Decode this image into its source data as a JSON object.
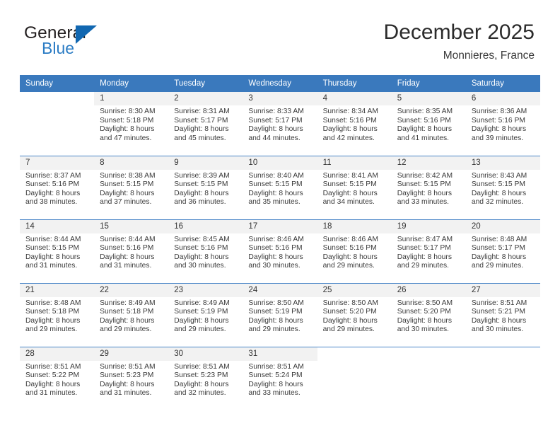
{
  "brand": {
    "name_top": "General",
    "name_bottom": "Blue",
    "accent_color": "#1167b1",
    "blue_text_color": "#2b7cc4"
  },
  "header": {
    "title": "December 2025",
    "subtitle": "Monnieres, France",
    "header_bg_color": "#3a79bd",
    "daynum_bg_color": "#f2f2f2"
  },
  "weekdays": [
    "Sunday",
    "Monday",
    "Tuesday",
    "Wednesday",
    "Thursday",
    "Friday",
    "Saturday"
  ],
  "weeks": [
    [
      {
        "day": ""
      },
      {
        "day": "1",
        "sunrise": "Sunrise: 8:30 AM",
        "sunset": "Sunset: 5:18 PM",
        "daylight_1": "Daylight: 8 hours",
        "daylight_2": "and 47 minutes."
      },
      {
        "day": "2",
        "sunrise": "Sunrise: 8:31 AM",
        "sunset": "Sunset: 5:17 PM",
        "daylight_1": "Daylight: 8 hours",
        "daylight_2": "and 45 minutes."
      },
      {
        "day": "3",
        "sunrise": "Sunrise: 8:33 AM",
        "sunset": "Sunset: 5:17 PM",
        "daylight_1": "Daylight: 8 hours",
        "daylight_2": "and 44 minutes."
      },
      {
        "day": "4",
        "sunrise": "Sunrise: 8:34 AM",
        "sunset": "Sunset: 5:16 PM",
        "daylight_1": "Daylight: 8 hours",
        "daylight_2": "and 42 minutes."
      },
      {
        "day": "5",
        "sunrise": "Sunrise: 8:35 AM",
        "sunset": "Sunset: 5:16 PM",
        "daylight_1": "Daylight: 8 hours",
        "daylight_2": "and 41 minutes."
      },
      {
        "day": "6",
        "sunrise": "Sunrise: 8:36 AM",
        "sunset": "Sunset: 5:16 PM",
        "daylight_1": "Daylight: 8 hours",
        "daylight_2": "and 39 minutes."
      }
    ],
    [
      {
        "day": "7",
        "sunrise": "Sunrise: 8:37 AM",
        "sunset": "Sunset: 5:16 PM",
        "daylight_1": "Daylight: 8 hours",
        "daylight_2": "and 38 minutes."
      },
      {
        "day": "8",
        "sunrise": "Sunrise: 8:38 AM",
        "sunset": "Sunset: 5:15 PM",
        "daylight_1": "Daylight: 8 hours",
        "daylight_2": "and 37 minutes."
      },
      {
        "day": "9",
        "sunrise": "Sunrise: 8:39 AM",
        "sunset": "Sunset: 5:15 PM",
        "daylight_1": "Daylight: 8 hours",
        "daylight_2": "and 36 minutes."
      },
      {
        "day": "10",
        "sunrise": "Sunrise: 8:40 AM",
        "sunset": "Sunset: 5:15 PM",
        "daylight_1": "Daylight: 8 hours",
        "daylight_2": "and 35 minutes."
      },
      {
        "day": "11",
        "sunrise": "Sunrise: 8:41 AM",
        "sunset": "Sunset: 5:15 PM",
        "daylight_1": "Daylight: 8 hours",
        "daylight_2": "and 34 minutes."
      },
      {
        "day": "12",
        "sunrise": "Sunrise: 8:42 AM",
        "sunset": "Sunset: 5:15 PM",
        "daylight_1": "Daylight: 8 hours",
        "daylight_2": "and 33 minutes."
      },
      {
        "day": "13",
        "sunrise": "Sunrise: 8:43 AM",
        "sunset": "Sunset: 5:15 PM",
        "daylight_1": "Daylight: 8 hours",
        "daylight_2": "and 32 minutes."
      }
    ],
    [
      {
        "day": "14",
        "sunrise": "Sunrise: 8:44 AM",
        "sunset": "Sunset: 5:15 PM",
        "daylight_1": "Daylight: 8 hours",
        "daylight_2": "and 31 minutes."
      },
      {
        "day": "15",
        "sunrise": "Sunrise: 8:44 AM",
        "sunset": "Sunset: 5:16 PM",
        "daylight_1": "Daylight: 8 hours",
        "daylight_2": "and 31 minutes."
      },
      {
        "day": "16",
        "sunrise": "Sunrise: 8:45 AM",
        "sunset": "Sunset: 5:16 PM",
        "daylight_1": "Daylight: 8 hours",
        "daylight_2": "and 30 minutes."
      },
      {
        "day": "17",
        "sunrise": "Sunrise: 8:46 AM",
        "sunset": "Sunset: 5:16 PM",
        "daylight_1": "Daylight: 8 hours",
        "daylight_2": "and 30 minutes."
      },
      {
        "day": "18",
        "sunrise": "Sunrise: 8:46 AM",
        "sunset": "Sunset: 5:16 PM",
        "daylight_1": "Daylight: 8 hours",
        "daylight_2": "and 29 minutes."
      },
      {
        "day": "19",
        "sunrise": "Sunrise: 8:47 AM",
        "sunset": "Sunset: 5:17 PM",
        "daylight_1": "Daylight: 8 hours",
        "daylight_2": "and 29 minutes."
      },
      {
        "day": "20",
        "sunrise": "Sunrise: 8:48 AM",
        "sunset": "Sunset: 5:17 PM",
        "daylight_1": "Daylight: 8 hours",
        "daylight_2": "and 29 minutes."
      }
    ],
    [
      {
        "day": "21",
        "sunrise": "Sunrise: 8:48 AM",
        "sunset": "Sunset: 5:18 PM",
        "daylight_1": "Daylight: 8 hours",
        "daylight_2": "and 29 minutes."
      },
      {
        "day": "22",
        "sunrise": "Sunrise: 8:49 AM",
        "sunset": "Sunset: 5:18 PM",
        "daylight_1": "Daylight: 8 hours",
        "daylight_2": "and 29 minutes."
      },
      {
        "day": "23",
        "sunrise": "Sunrise: 8:49 AM",
        "sunset": "Sunset: 5:19 PM",
        "daylight_1": "Daylight: 8 hours",
        "daylight_2": "and 29 minutes."
      },
      {
        "day": "24",
        "sunrise": "Sunrise: 8:50 AM",
        "sunset": "Sunset: 5:19 PM",
        "daylight_1": "Daylight: 8 hours",
        "daylight_2": "and 29 minutes."
      },
      {
        "day": "25",
        "sunrise": "Sunrise: 8:50 AM",
        "sunset": "Sunset: 5:20 PM",
        "daylight_1": "Daylight: 8 hours",
        "daylight_2": "and 29 minutes."
      },
      {
        "day": "26",
        "sunrise": "Sunrise: 8:50 AM",
        "sunset": "Sunset: 5:20 PM",
        "daylight_1": "Daylight: 8 hours",
        "daylight_2": "and 30 minutes."
      },
      {
        "day": "27",
        "sunrise": "Sunrise: 8:51 AM",
        "sunset": "Sunset: 5:21 PM",
        "daylight_1": "Daylight: 8 hours",
        "daylight_2": "and 30 minutes."
      }
    ],
    [
      {
        "day": "28",
        "sunrise": "Sunrise: 8:51 AM",
        "sunset": "Sunset: 5:22 PM",
        "daylight_1": "Daylight: 8 hours",
        "daylight_2": "and 31 minutes."
      },
      {
        "day": "29",
        "sunrise": "Sunrise: 8:51 AM",
        "sunset": "Sunset: 5:23 PM",
        "daylight_1": "Daylight: 8 hours",
        "daylight_2": "and 31 minutes."
      },
      {
        "day": "30",
        "sunrise": "Sunrise: 8:51 AM",
        "sunset": "Sunset: 5:23 PM",
        "daylight_1": "Daylight: 8 hours",
        "daylight_2": "and 32 minutes."
      },
      {
        "day": "31",
        "sunrise": "Sunrise: 8:51 AM",
        "sunset": "Sunset: 5:24 PM",
        "daylight_1": "Daylight: 8 hours",
        "daylight_2": "and 33 minutes."
      },
      {
        "day": ""
      },
      {
        "day": ""
      },
      {
        "day": ""
      }
    ]
  ]
}
